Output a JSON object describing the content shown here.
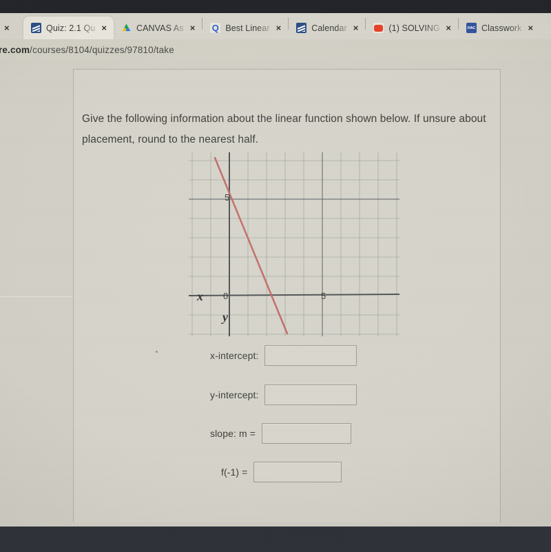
{
  "browser": {
    "tabs": [
      {
        "title": "",
        "icon": "partial-tab-icon",
        "close_label": "×",
        "active": false,
        "partial": true
      },
      {
        "title": "Quiz: 2.1 Qu",
        "icon": "canvas-quiz-favicon",
        "close_label": "×",
        "active": true,
        "partial": false
      },
      {
        "title": "CANVAS As",
        "icon": "google-drive-favicon",
        "close_label": "×",
        "active": false,
        "partial": false
      },
      {
        "title": "Best Linear",
        "icon": "quizlet-favicon",
        "close_label": "×",
        "active": false,
        "partial": false
      },
      {
        "title": "Calendar",
        "icon": "canvas-calendar-favicon",
        "close_label": "×",
        "active": false,
        "partial": false
      },
      {
        "title": "(1) SOLVING",
        "icon": "youtube-favicon",
        "close_label": "×",
        "active": false,
        "partial": false
      },
      {
        "title": "Classwork",
        "icon": "hac-favicon",
        "close_label": "×",
        "active": false,
        "partial": false
      }
    ],
    "url_domain": "re.com",
    "url_path": "/courses/8104/quizzes/97810/take"
  },
  "quiz": {
    "question_text": "Give the following information about the linear function shown below. If unsure about placement, round to the nearest half.",
    "fields": [
      {
        "label": "x-intercept:",
        "value": "",
        "placeholder": ""
      },
      {
        "label": "y-intercept:",
        "value": "",
        "placeholder": ""
      },
      {
        "label": "slope:  m =",
        "value": "",
        "placeholder": ""
      },
      {
        "label": "f(-1) =",
        "value": "",
        "placeholder": ""
      }
    ]
  },
  "chart_data": {
    "type": "line",
    "title": "",
    "xlabel": "x",
    "ylabel": "y",
    "xlim": [
      -2.2,
      9.0
    ],
    "ylim": [
      -2.4,
      7.0
    ],
    "xticks": [
      0,
      5
    ],
    "yticks": [
      5
    ],
    "xtick_labels": [
      "0",
      "5"
    ],
    "ytick_labels": [
      "5"
    ],
    "grid": true,
    "grid_step": 1,
    "grid_color": "#8f9a8f",
    "axis_color": "#53565a",
    "series": [
      {
        "name": "linear function",
        "color": "#c0655f",
        "slope": -2.5,
        "y_intercept": 4.5,
        "x_intercept": 1.8,
        "points": [
          [
            -0.8,
            6.5
          ],
          [
            3.1,
            -3.2
          ]
        ]
      }
    ],
    "annotations": []
  },
  "colors": {
    "page_background": "#d2d0c6",
    "card_background": "#d6d4ca",
    "line_color": "#c0655f",
    "grid_color": "#8f9a8f",
    "axis_color": "#53565a",
    "text_color": "#3b3b38",
    "bezel_color": "#22242a"
  }
}
